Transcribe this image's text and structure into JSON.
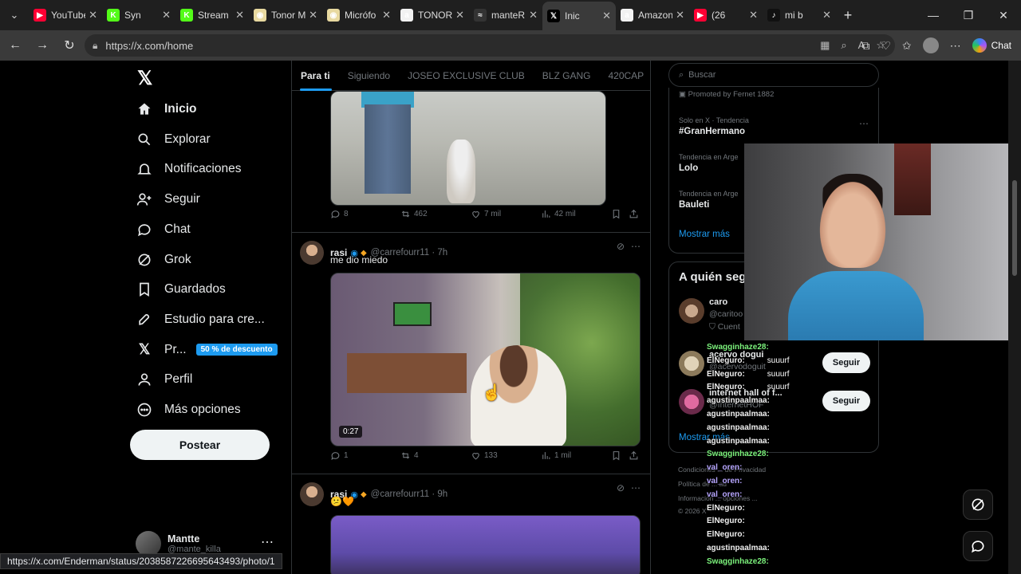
{
  "browser": {
    "tabs": [
      {
        "title": "YouTube",
        "fav": "youtube-icon",
        "color": "#ff0033",
        "glyph": "▶"
      },
      {
        "title": "Syn",
        "fav": "kick-icon",
        "color": "#53fc18",
        "glyph": "K"
      },
      {
        "title": "Stream",
        "fav": "kick-icon",
        "color": "#53fc18",
        "glyph": "K"
      },
      {
        "title": "Tonor M",
        "fav": "tonor-icon",
        "color": "#e8d9a0",
        "glyph": "◉"
      },
      {
        "title": "Micrófo",
        "fav": "tonor-icon",
        "color": "#e8d9a0",
        "glyph": "◉"
      },
      {
        "title": "TONOR",
        "fav": "amazon-icon",
        "color": "#f2f2f2",
        "glyph": "a"
      },
      {
        "title": "manteR",
        "fav": "stream-icon",
        "color": "#333",
        "glyph": "≈"
      },
      {
        "title": "Inic",
        "fav": "x-icon",
        "color": "#000",
        "glyph": "𝕏"
      },
      {
        "title": "Amazon",
        "fav": "amazon-icon",
        "color": "#f2f2f2",
        "glyph": "a"
      },
      {
        "title": "(26",
        "fav": "youtube-icon",
        "color": "#ff0033",
        "glyph": "▶"
      },
      {
        "title": "mi b",
        "fav": "tiktok-icon",
        "color": "#111",
        "glyph": "♪"
      }
    ],
    "url": "https://x.com/home",
    "chat_label": "Chat",
    "status_url": "https://x.com/Enderman/status/2038587226695643493/photo/1"
  },
  "nav": {
    "items": [
      {
        "label": "Inicio",
        "icon": "home-icon"
      },
      {
        "label": "Explorar",
        "icon": "search-icon"
      },
      {
        "label": "Notificaciones",
        "icon": "bell-icon"
      },
      {
        "label": "Seguir",
        "icon": "follow-icon"
      },
      {
        "label": "Chat",
        "icon": "chat-icon"
      },
      {
        "label": "Grok",
        "icon": "grok-icon"
      },
      {
        "label": "Guardados",
        "icon": "bookmark-icon"
      },
      {
        "label": "Estudio para cre...",
        "icon": "rocket-icon"
      },
      {
        "label": "Pr...",
        "icon": "x-premium-icon"
      },
      {
        "label": "Perfil",
        "icon": "profile-icon"
      },
      {
        "label": "Más opciones",
        "icon": "more-icon"
      }
    ],
    "premium_badge": "50 % de descuento",
    "post_button": "Postear",
    "user": {
      "name": "Mantte",
      "handle": "@mante_killa"
    }
  },
  "feed": {
    "tabs": [
      "Para ti",
      "Siguiendo",
      "JOSEO EXCLUSIVE CLUB",
      "BLZ GANG",
      "420CAP"
    ],
    "post1_actions": {
      "replies": "8",
      "reposts": "462",
      "likes": "7 mil",
      "views": "42 mil"
    },
    "post2": {
      "name": "rasi",
      "handle": "@carrefourr11",
      "time": "7h",
      "text": "me dio miedo",
      "duration": "0:27",
      "actions": {
        "replies": "1",
        "reposts": "4",
        "likes": "133",
        "views": "1 mil"
      }
    },
    "post3": {
      "name": "rasi",
      "handle": "@carrefourr11",
      "time": "9h",
      "text": "😕🧡"
    }
  },
  "right": {
    "search_placeholder": "Buscar",
    "promoted": "Promoted by Fernet 1882",
    "trends": [
      {
        "context": "Solo en X · Tendencia",
        "name": "#GranHermano"
      },
      {
        "context": "Tendencia en Arge",
        "name": "Lolo"
      },
      {
        "context": "Tendencia en Arge",
        "name": "Bauleti"
      }
    ],
    "show_more": "Mostrar más",
    "wtf_title": "A quién seg",
    "wtf": [
      {
        "name": "caro",
        "handle": "@caritoo",
        "sub": "Cuent"
      },
      {
        "name": "acervo dogui",
        "handle": "@acervodoguit",
        "follow": "Seguir"
      },
      {
        "name": "internet hall of f...",
        "handle": "@InternetHOF",
        "follow": "Seguir"
      }
    ],
    "show_more2": "Mostrar más",
    "footer": [
      "Condiciones ... de Privacidad",
      "Política de ... ad",
      "Información ... opciones ...",
      "© 2026 X"
    ]
  },
  "chat_overlay": [
    {
      "user": "Swagginhaze28:",
      "cls": "c1",
      "msg": ""
    },
    {
      "user": "ElNeguro:",
      "cls": "c2",
      "msg": "suuurf"
    },
    {
      "user": "ElNeguro:",
      "cls": "c2",
      "msg": "suuurf"
    },
    {
      "user": "ElNeguro:",
      "cls": "c2",
      "msg": "suuurf"
    },
    {
      "user": "agustinpaalmaa:",
      "cls": "c2",
      "msg": ""
    },
    {
      "user": "agustinpaalmaa:",
      "cls": "c2",
      "msg": ""
    },
    {
      "user": "agustinpaalmaa:",
      "cls": "c2",
      "msg": ""
    },
    {
      "user": "agustinpaalmaa:",
      "cls": "c2",
      "msg": ""
    },
    {
      "user": "Swagginhaze28:",
      "cls": "c1",
      "msg": ""
    },
    {
      "user": "val_oren:",
      "cls": "c3",
      "msg": ""
    },
    {
      "user": "val_oren:",
      "cls": "c3",
      "msg": ""
    },
    {
      "user": "val_oren:",
      "cls": "c3",
      "msg": ""
    },
    {
      "user": "ElNeguro:",
      "cls": "c2",
      "msg": ""
    },
    {
      "user": "ElNeguro:",
      "cls": "c2",
      "msg": ""
    },
    {
      "user": "ElNeguro:",
      "cls": "c2",
      "msg": ""
    },
    {
      "user": "agustinpaalmaa:",
      "cls": "c2",
      "msg": ""
    },
    {
      "user": "Swagginhaze28:",
      "cls": "c1",
      "msg": ""
    }
  ]
}
